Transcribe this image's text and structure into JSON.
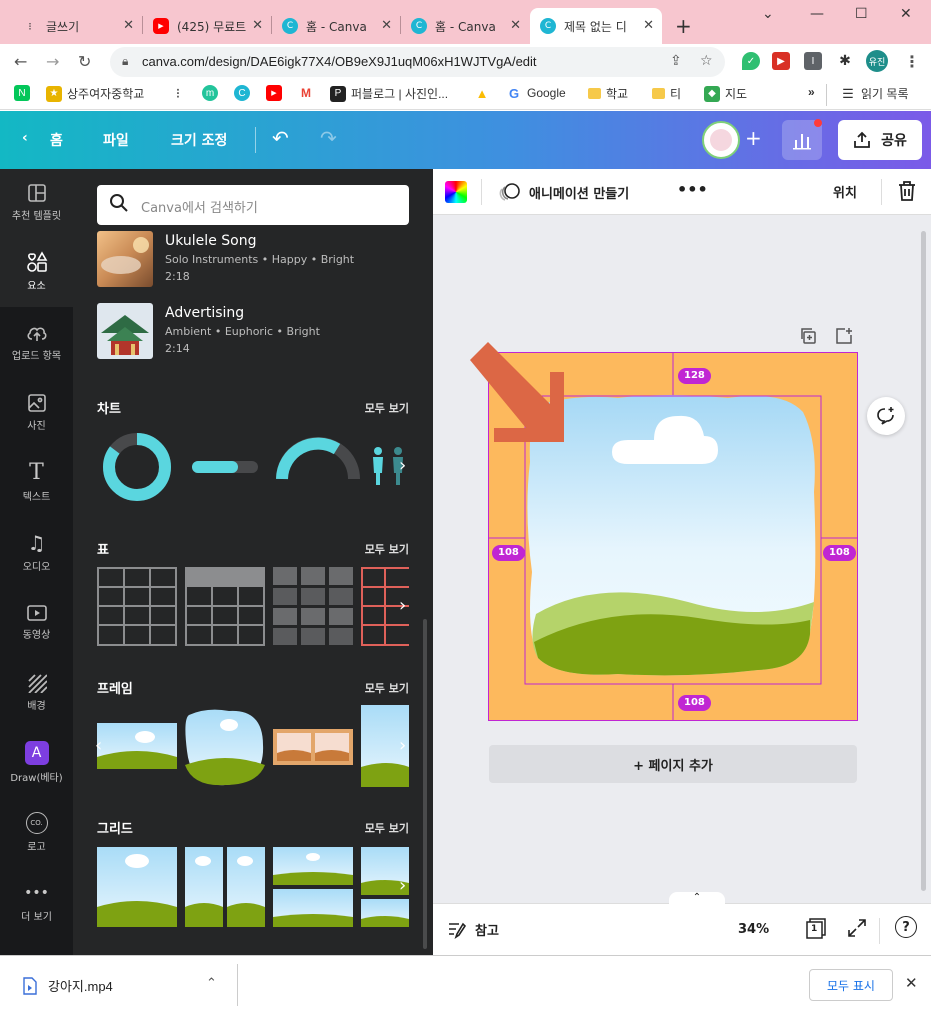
{
  "browser": {
    "tabs": [
      {
        "title": "글쓰기",
        "icon": "dots-icon",
        "active": false
      },
      {
        "title": "(425) 무료트",
        "icon": "youtube-icon",
        "active": false
      },
      {
        "title": "홈 - Canva",
        "icon": "canva-icon",
        "active": false
      },
      {
        "title": "홈 - Canva",
        "icon": "canva-icon",
        "active": false
      },
      {
        "title": "제목 없는 디",
        "icon": "canva-icon",
        "active": true
      }
    ],
    "url": "canva.com/design/DAE6igk77X4/OB9eX9J1uqM06xH1WJTVgA/edit",
    "profile_label": "유진",
    "bookmarks": [
      {
        "label": "",
        "icon": "naver-icon",
        "color": "#03c75a",
        "glyph": "N"
      },
      {
        "label": "상주여자중학교",
        "icon": "school-icon",
        "color": "#e8b400",
        "glyph": "★"
      },
      {
        "label": "",
        "icon": "dots-icon",
        "color": "#555555",
        "glyph": "⁝"
      },
      {
        "label": "",
        "icon": "m-icon",
        "color": "#23c49b",
        "glyph": "m"
      },
      {
        "label": "",
        "icon": "canva-icon",
        "color": "#1fb6d3",
        "glyph": "C"
      },
      {
        "label": "",
        "icon": "youtube-icon",
        "color": "#ff0000",
        "glyph": "▶"
      },
      {
        "label": "",
        "icon": "gmail-icon",
        "color": "#ea4335",
        "glyph": "M"
      },
      {
        "label": "퍼블로그 | 사진인...",
        "icon": "p-icon",
        "color": "#222222",
        "glyph": "P"
      },
      {
        "label": "",
        "icon": "drive-icon",
        "color": "#fbbc04",
        "glyph": "▲"
      },
      {
        "label": "Google",
        "icon": "google-icon",
        "color": "#4285f4",
        "glyph": "G"
      },
      {
        "label": "",
        "icon": "folder-icon",
        "color": "#f6c94a",
        "glyph": ""
      },
      {
        "label": "학교",
        "icon": "folder-icon",
        "color": "#f6c94a",
        "glyph": ""
      },
      {
        "label": "티",
        "icon": "folder-icon",
        "color": "#f6c94a",
        "glyph": ""
      },
      {
        "label": "지도",
        "icon": "maps-icon",
        "color": "#34a853",
        "glyph": "◆"
      }
    ],
    "bookmarks_more": "»",
    "reading_list": "읽기 목록"
  },
  "canva": {
    "header": {
      "home": "홈",
      "file": "파일",
      "resize": "크기 조정",
      "share": "공유"
    },
    "rail": [
      {
        "label": "추천 템플릿",
        "icon": "template-icon",
        "glyph": "▦"
      },
      {
        "label": "요소",
        "icon": "elements-icon",
        "glyph": "♡△"
      },
      {
        "label": "업로드 항목",
        "icon": "upload-cloud-icon",
        "glyph": "☁"
      },
      {
        "label": "사진",
        "icon": "photo-icon",
        "glyph": "▣"
      },
      {
        "label": "텍스트",
        "icon": "text-icon",
        "glyph": "T"
      },
      {
        "label": "오디오",
        "icon": "audio-icon",
        "glyph": "♫"
      },
      {
        "label": "동영상",
        "icon": "video-icon",
        "glyph": "▶"
      },
      {
        "label": "배경",
        "icon": "background-icon",
        "glyph": "▨"
      },
      {
        "label": "Draw(베타)",
        "icon": "draw-icon",
        "glyph": "A"
      },
      {
        "label": "로고",
        "icon": "logo-icon",
        "glyph": "CO."
      },
      {
        "label": "더 보기",
        "icon": "more-icon",
        "glyph": "•••"
      }
    ],
    "search_placeholder": "Canva에서 검색하기",
    "audio": [
      {
        "title": "Ukulele Song",
        "tags": "Solo Instruments • Happy • Bright",
        "duration": "2:18"
      },
      {
        "title": "Advertising",
        "tags": "Ambient • Euphoric • Bright",
        "duration": "2:14"
      }
    ],
    "sections": {
      "chart": "차트",
      "table": "표",
      "frame": "프레임",
      "grid": "그리드",
      "see_all": "모두 보기"
    },
    "toolbar": {
      "animate": "애니메이션 만들기",
      "more": "•••",
      "position": "위치"
    },
    "guides": {
      "top": "128",
      "left": "108",
      "right": "108",
      "bottom": "108"
    },
    "add_page": "+ 페이지 추가",
    "notes": "참고",
    "zoom": "34%",
    "page_count": "1",
    "help": "?"
  },
  "downloads": {
    "file": "강아지.mp4",
    "show_all": "모두 표시"
  },
  "colors": {
    "page_bg": "#fdb95d",
    "guide": "#c026d3",
    "arrow": "#dc6745",
    "sky": "#bfe6fb",
    "grass_dark": "#7ea212",
    "grass_light": "#b5d36a"
  }
}
